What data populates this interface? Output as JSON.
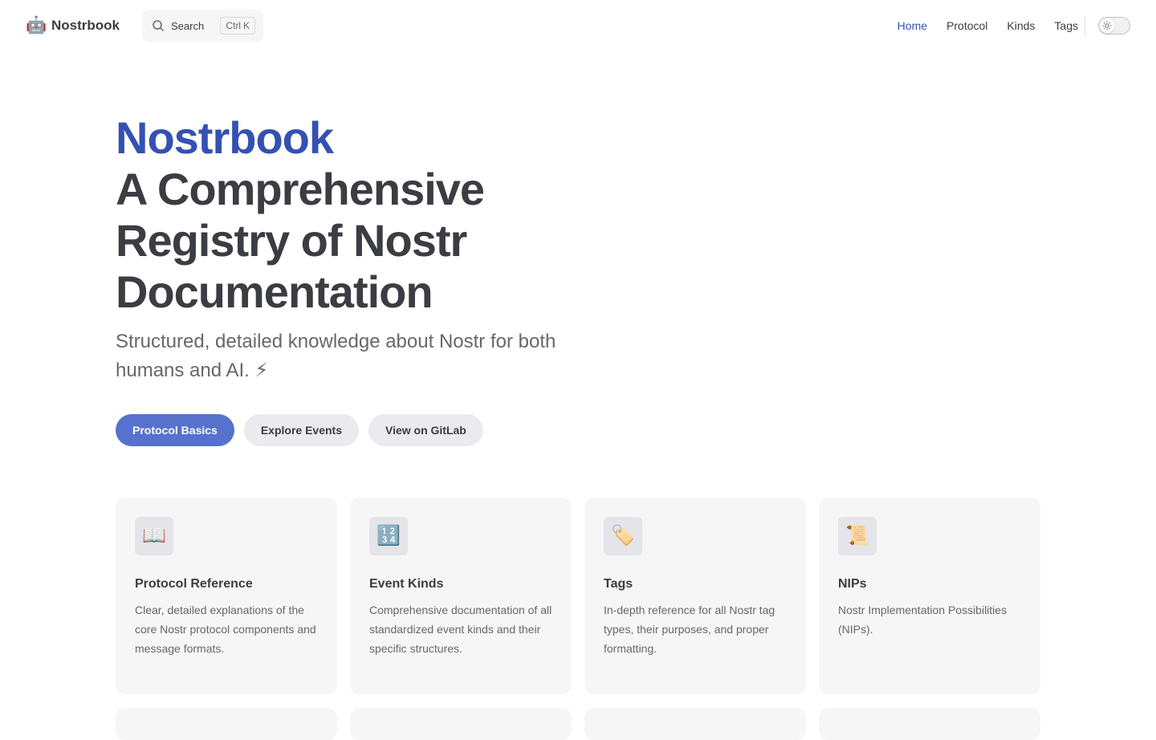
{
  "nav": {
    "logo_emoji": "🤖",
    "title": "Nostrbook",
    "search": {
      "label": "Search",
      "key_ctrl": "Ctrl",
      "key_k": "K"
    },
    "links": [
      {
        "label": "Home",
        "active": true
      },
      {
        "label": "Protocol",
        "active": false
      },
      {
        "label": "Kinds",
        "active": false
      },
      {
        "label": "Tags",
        "active": false
      }
    ],
    "theme_toggle": {
      "icon": "sun-icon"
    }
  },
  "hero": {
    "name": "Nostrbook",
    "text": "A Comprehensive Registry of Nostr Documentation",
    "tagline": "Structured, detailed knowledge about Nostr for both humans and AI. ⚡",
    "actions": [
      {
        "label": "Protocol Basics",
        "theme": "brand"
      },
      {
        "label": "Explore Events",
        "theme": "alt"
      },
      {
        "label": "View on GitLab",
        "theme": "alt"
      }
    ]
  },
  "features": [
    {
      "icon": "📖",
      "title": "Protocol Reference",
      "details": "Clear, detailed explanations of the core Nostr protocol components and message formats."
    },
    {
      "icon": "🔢",
      "title": "Event Kinds",
      "details": "Comprehensive documentation of all standardized event kinds and their specific structures."
    },
    {
      "icon": "🏷️",
      "title": "Tags",
      "details": "In-depth reference for all Nostr tag types, their purposes, and proper formatting."
    },
    {
      "icon": "📜",
      "title": "NIPs",
      "details": "Nostr Implementation Possibilities (NIPs)."
    }
  ],
  "colors": {
    "brand": "#3451b2",
    "button_brand": "#5672cd",
    "text": "#3c3c43",
    "muted": "#67676c",
    "card_bg": "#f6f6f7"
  }
}
